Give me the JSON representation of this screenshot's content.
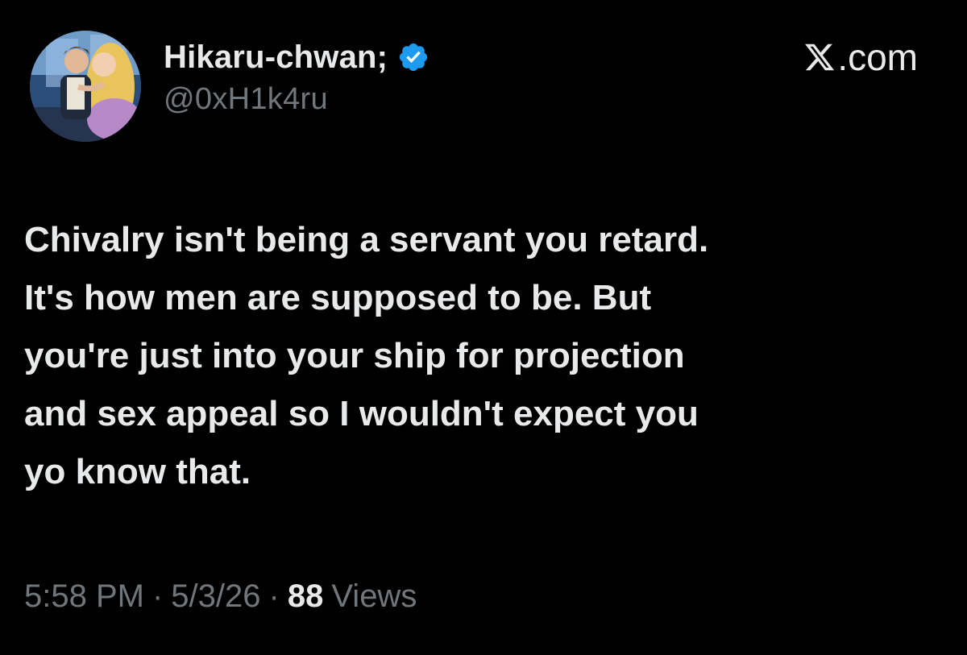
{
  "author": {
    "display_name": "Hikaru-chwan;",
    "handle": "@0xH1k4ru",
    "verified_icon": "verified-badge-icon",
    "avatar_icon": "avatar-image"
  },
  "brand": {
    "icon": "x-logo-icon",
    "label": ".com"
  },
  "tweet": {
    "text": "Chivalry isn't being a servant you retard.\nIt's how men are supposed to be. But\nyou're just into your ship for projection\nand sex appeal so I wouldn't expect you\nyo know that."
  },
  "meta": {
    "time": "5:58 PM",
    "separator": "·",
    "date": "5/3/26",
    "views_count": "88",
    "views_label": "Views"
  },
  "colors": {
    "background": "#000000",
    "primary_text": "#e7e9ea",
    "secondary_text": "#71767b",
    "verified_blue": "#1d9bf0"
  }
}
